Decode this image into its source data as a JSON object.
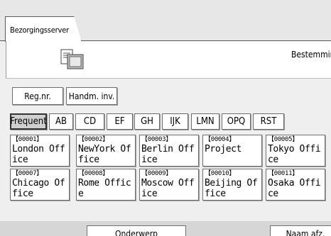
{
  "tab": {
    "label": "Bezorgingsserver"
  },
  "header": {
    "destination_label": "Bestemming",
    "icon": "document-list-icon"
  },
  "tools": {
    "reg_nr": "Reg.nr.",
    "manual_input": "Handm. inv."
  },
  "categories": [
    {
      "label": "Frequent",
      "selected": true
    },
    {
      "label": "AB"
    },
    {
      "label": "CD"
    },
    {
      "label": "EF"
    },
    {
      "label": "GH"
    },
    {
      "label": "IJK"
    },
    {
      "label": "LMN"
    },
    {
      "label": "OPQ"
    },
    {
      "label": "RST"
    }
  ],
  "destinations": [
    {
      "num": "【00001】",
      "name": "London Office"
    },
    {
      "num": "【00002】",
      "name": "NewYork Office"
    },
    {
      "num": "【00003】",
      "name": "Berlin Office"
    },
    {
      "num": "【00004】",
      "name": "Project"
    },
    {
      "num": "【00005】",
      "name": "Tokyo Office"
    },
    {
      "num": "【00007】",
      "name": "Chicago Office"
    },
    {
      "num": "【00008】",
      "name": "Rome Office"
    },
    {
      "num": "【00009】",
      "name": "Moscow Office"
    },
    {
      "num": "【00010】",
      "name": "Beijing Office"
    },
    {
      "num": "【00011】",
      "name": "Osaka Office"
    }
  ],
  "bottom": {
    "search": "Onderwerp",
    "sender": "Naam afz."
  }
}
